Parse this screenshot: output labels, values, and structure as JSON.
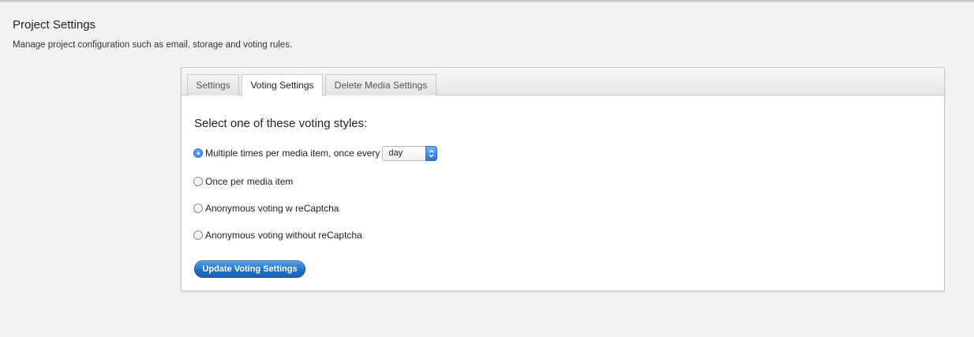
{
  "page": {
    "title": "Project Settings",
    "subtitle": "Manage project configuration such as email, storage and voting rules."
  },
  "tabs": [
    {
      "label": "Settings",
      "active": false
    },
    {
      "label": "Voting Settings",
      "active": true
    },
    {
      "label": "Delete Media Settings",
      "active": false
    }
  ],
  "voting": {
    "heading": "Select one of these voting styles:",
    "options": [
      {
        "label": "Multiple times per media item, once every",
        "checked": true
      },
      {
        "label": "Once per media item",
        "checked": false
      },
      {
        "label": "Anonymous voting w reCaptcha",
        "checked": false
      },
      {
        "label": "Anonymous voting without reCaptcha",
        "checked": false
      }
    ],
    "frequency_select": {
      "value": "day"
    },
    "submit_label": "Update Voting Settings"
  },
  "colors": {
    "accent": "#2a7fe8",
    "button": "#1f6fc4",
    "background": "#f2f2f2"
  },
  "icons": {
    "select_arrows": "up-down-chevron-icon"
  }
}
